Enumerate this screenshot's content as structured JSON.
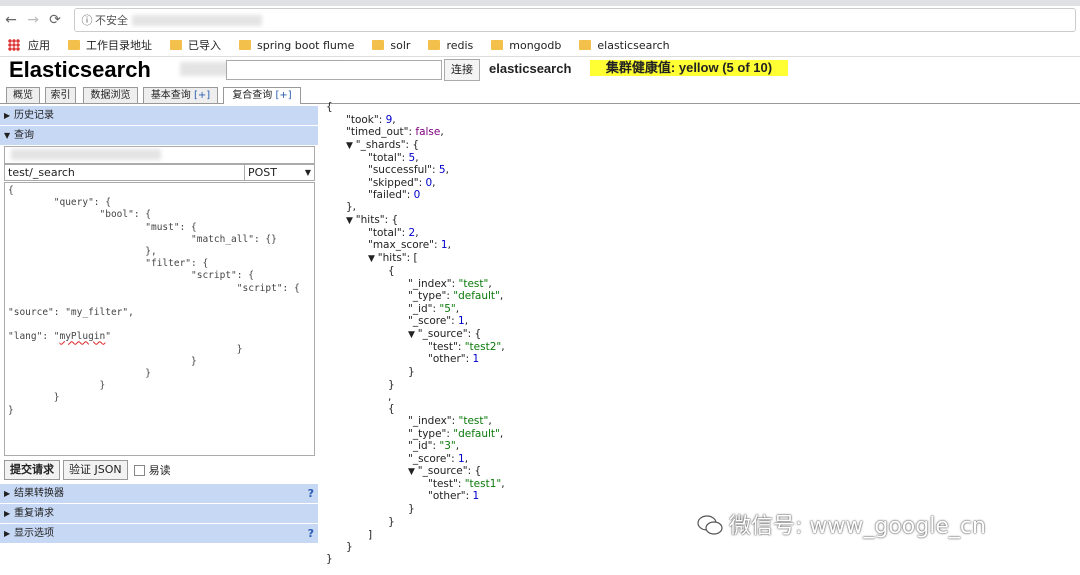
{
  "browser": {
    "security_label": "不安全",
    "bookmarks": [
      "应用",
      "工作目录地址",
      "已导入",
      "spring boot flume",
      "solr",
      "redis",
      "mongodb",
      "elasticsearch"
    ]
  },
  "app": {
    "title": "Elasticsearch",
    "connect_label": "连接",
    "cluster_name": "elasticsearch",
    "health": "集群健康值: yellow (5 of 10)",
    "health_color": "#ffff33"
  },
  "tabs": [
    "概览",
    "索引",
    "数据浏览",
    "基本查询",
    "复合查询"
  ],
  "tab_plus": "[+]",
  "left": {
    "history_label": "历史记录",
    "query_label": "查询",
    "path": "test/_search",
    "method": "POST",
    "submit_label": "提交请求",
    "validate_label": "验证 JSON",
    "pretty_label": "易读",
    "result_transformer_label": "结果转换器",
    "repeat_request_label": "重复请求",
    "display_options_label": "显示选项",
    "help_mark": "?",
    "editor_lines": [
      "{",
      "        \"query\": {",
      "                \"bool\": {",
      "                        \"must\": {",
      "                                \"match_all\": {}",
      "                        },",
      "                        \"filter\": {",
      "                                \"script\": {",
      "                                        \"script\": {",
      "",
      "\"source\": \"my_filter\",",
      "",
      "\"lang\": \"myPlugin\"",
      "                                        }",
      "                                }",
      "                        }",
      "                }",
      "        }",
      "}"
    ]
  },
  "response": {
    "took": "9",
    "timed_out": "false",
    "shards_total": "5",
    "shards_successful": "5",
    "shards_skipped": "0",
    "shards_failed": "0",
    "hits_total": "2",
    "max_score": "1",
    "hit1": {
      "index": "\"test\"",
      "type": "\"default\"",
      "id": "\"5\"",
      "score": "1",
      "test": "\"test2\"",
      "other": "1"
    },
    "hit2": {
      "index": "\"test\"",
      "type": "\"default\"",
      "id": "\"3\"",
      "score": "1",
      "test": "\"test1\"",
      "other": "1"
    }
  },
  "watermark": "微信号: www_google_cn"
}
